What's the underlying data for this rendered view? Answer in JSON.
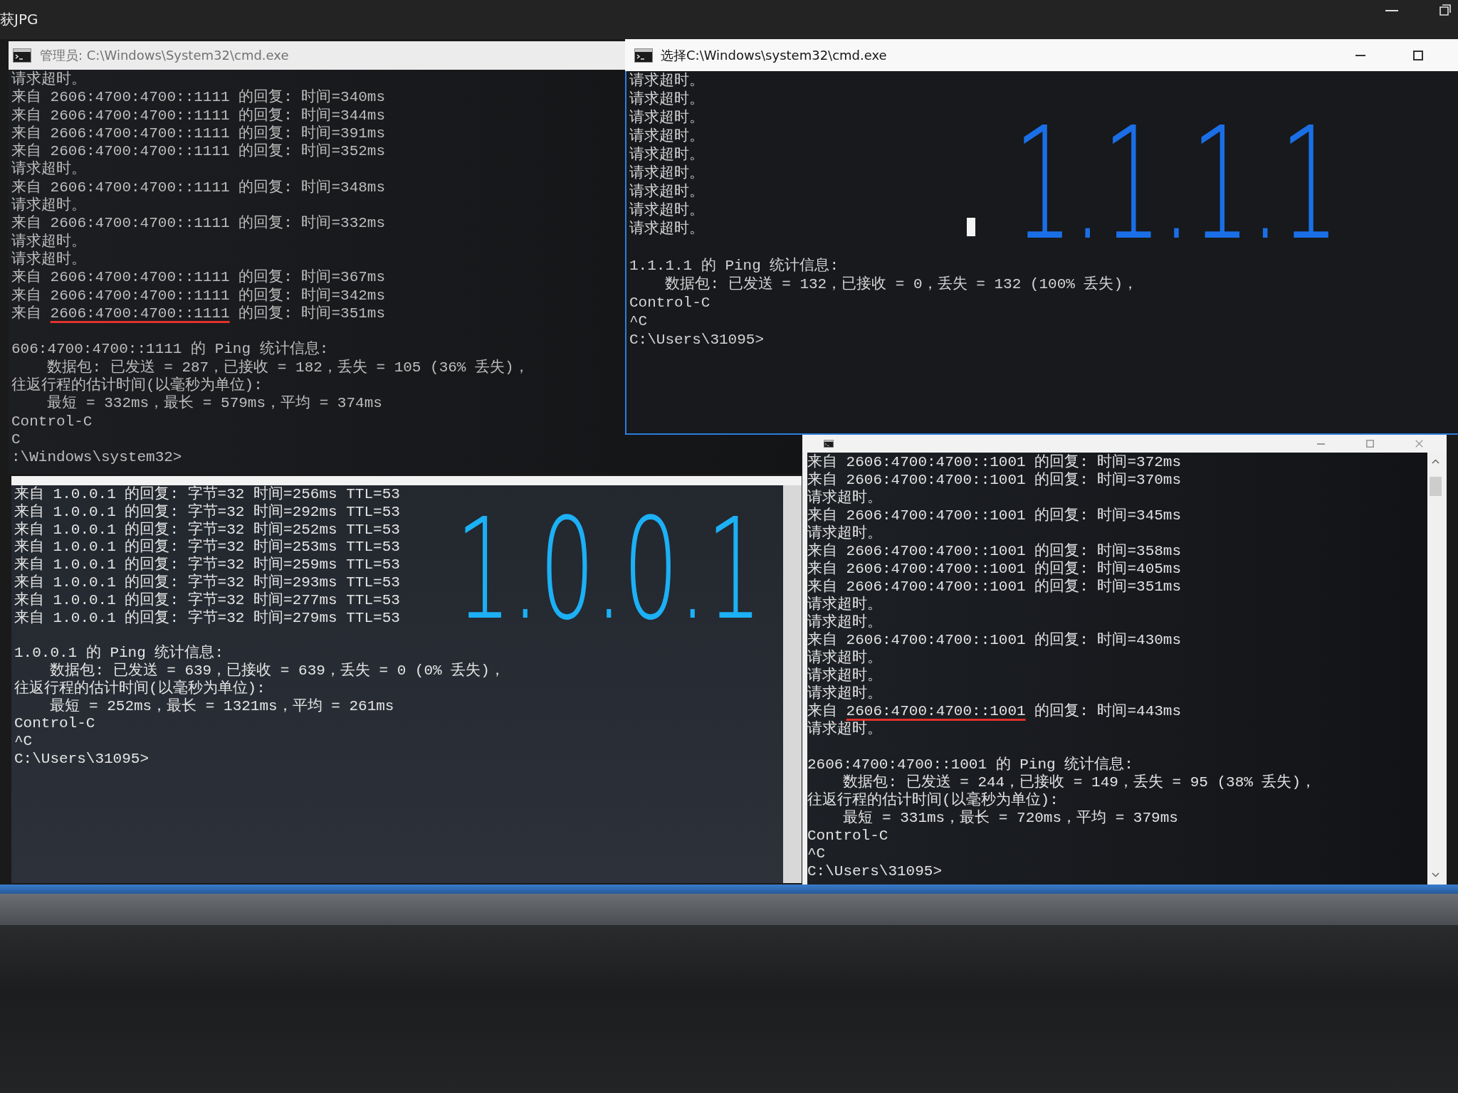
{
  "viewer": {
    "title": "获JPG"
  },
  "windows": [
    {
      "title": "管理员: C:\\Windows\\System32\\cmd.exe",
      "active": false,
      "cursor": false,
      "replies": [
        {
          "text": "请求超时。",
          "underlined": false
        },
        {
          "text": "来自 2606:4700:4700::1111 的回复: 时间=340ms",
          "underlined": false
        },
        {
          "text": "来自 2606:4700:4700::1111 的回复: 时间=344ms",
          "underlined": false
        },
        {
          "text": "来自 2606:4700:4700::1111 的回复: 时间=391ms",
          "underlined": false
        },
        {
          "text": "来自 2606:4700:4700::1111 的回复: 时间=352ms",
          "underlined": false
        },
        {
          "text": "请求超时。",
          "underlined": false
        },
        {
          "text": "来自 2606:4700:4700::1111 的回复: 时间=348ms",
          "underlined": false
        },
        {
          "text": "请求超时。",
          "underlined": false
        },
        {
          "text": "来自 2606:4700:4700::1111 的回复: 时间=332ms",
          "underlined": false
        },
        {
          "text": "请求超时。",
          "underlined": false
        },
        {
          "text": "请求超时。",
          "underlined": false
        },
        {
          "text": "来自 2606:4700:4700::1111 的回复: 时间=367ms",
          "underlined": false
        },
        {
          "text": "来自 2606:4700:4700::1111 的回复: 时间=342ms",
          "underlined": false
        },
        {
          "text": "来自 2606:4700:4700::1111 的回复: 时间=351ms",
          "underlined": true
        }
      ],
      "summary": [
        {
          "text": "606:4700:4700::1111 的 Ping 统计信息:",
          "indented": false
        },
        {
          "text": "数据包: 已发送 = 287，已接收 = 182，丢失 = 105 (36% 丢失)，",
          "indented": true
        },
        {
          "text": "往返行程的估计时间(以毫秒为单位):",
          "indented": false
        },
        {
          "text": "最短 = 332ms，最长 = 579ms，平均 = 374ms",
          "indented": true
        },
        {
          "text": "Control-C",
          "indented": false
        },
        {
          "text": "C",
          "indented": false
        },
        {
          "text": ":\\Windows\\system32>",
          "indented": false
        }
      ]
    },
    {
      "title": "选择C:\\Windows\\system32\\cmd.exe",
      "active": true,
      "cursor": true,
      "handwriting": {
        "text": "1.1.1.1",
        "color": "#1a6fe6"
      },
      "replies": [
        {
          "text": "请求超时。",
          "underlined": false
        },
        {
          "text": "请求超时。",
          "underlined": false
        },
        {
          "text": "请求超时。",
          "underlined": false
        },
        {
          "text": "请求超时。",
          "underlined": false
        },
        {
          "text": "请求超时。",
          "underlined": false
        },
        {
          "text": "请求超时。",
          "underlined": false
        },
        {
          "text": "请求超时。",
          "underlined": false
        },
        {
          "text": "请求超时。",
          "underlined": false
        },
        {
          "text": "请求超时。",
          "underlined": false
        }
      ],
      "summary": [
        {
          "text": "1.1.1.1 的 Ping 统计信息:",
          "indented": false
        },
        {
          "text": "数据包: 已发送 = 132，已接收 = 0，丢失 = 132 (100% 丢失)，",
          "indented": true
        },
        {
          "text": "Control-C",
          "indented": false
        },
        {
          "text": "^C",
          "indented": false
        },
        {
          "text": "C:\\Users\\31095>",
          "indented": false
        }
      ]
    },
    {
      "active": false,
      "cursor": false,
      "handwriting": {
        "text": "1.0.0.1",
        "color": "#1cb0f5"
      },
      "replies": [
        {
          "text": "来自 1.0.0.1 的回复: 字节=32 时间=256ms TTL=53",
          "underlined": false
        },
        {
          "text": "来自 1.0.0.1 的回复: 字节=32 时间=292ms TTL=53",
          "underlined": false
        },
        {
          "text": "来自 1.0.0.1 的回复: 字节=32 时间=252ms TTL=53",
          "underlined": false
        },
        {
          "text": "来自 1.0.0.1 的回复: 字节=32 时间=253ms TTL=53",
          "underlined": false
        },
        {
          "text": "来自 1.0.0.1 的回复: 字节=32 时间=259ms TTL=53",
          "underlined": false
        },
        {
          "text": "来自 1.0.0.1 的回复: 字节=32 时间=293ms TTL=53",
          "underlined": false
        },
        {
          "text": "来自 1.0.0.1 的回复: 字节=32 时间=277ms TTL=53",
          "underlined": false
        },
        {
          "text": "来自 1.0.0.1 的回复: 字节=32 时间=279ms TTL=53",
          "underlined": false
        }
      ],
      "summary": [
        {
          "text": "1.0.0.1 的 Ping 统计信息:",
          "indented": false
        },
        {
          "text": "数据包: 已发送 = 639，已接收 = 639，丢失 = 0 (0% 丢失)，",
          "indented": true
        },
        {
          "text": "往返行程的估计时间(以毫秒为单位):",
          "indented": false
        },
        {
          "text": "最短 = 252ms，最长 = 1321ms，平均 = 261ms",
          "indented": true
        },
        {
          "text": "Control-C",
          "indented": false
        },
        {
          "text": "^C",
          "indented": false
        },
        {
          "text": "C:\\Users\\31095>",
          "indented": false
        }
      ]
    },
    {
      "active": false,
      "cursor": false,
      "replies": [
        {
          "text": "来自 2606:4700:4700::1001 的回复: 时间=372ms",
          "underlined": false
        },
        {
          "text": "来自 2606:4700:4700::1001 的回复: 时间=370ms",
          "underlined": false
        },
        {
          "text": "请求超时。",
          "underlined": false
        },
        {
          "text": "来自 2606:4700:4700::1001 的回复: 时间=345ms",
          "underlined": false
        },
        {
          "text": "请求超时。",
          "underlined": false
        },
        {
          "text": "来自 2606:4700:4700::1001 的回复: 时间=358ms",
          "underlined": false
        },
        {
          "text": "来自 2606:4700:4700::1001 的回复: 时间=405ms",
          "underlined": false
        },
        {
          "text": "来自 2606:4700:4700::1001 的回复: 时间=351ms",
          "underlined": false
        },
        {
          "text": "请求超时。",
          "underlined": false
        },
        {
          "text": "请求超时。",
          "underlined": false
        },
        {
          "text": "来自 2606:4700:4700::1001 的回复: 时间=430ms",
          "underlined": false
        },
        {
          "text": "请求超时。",
          "underlined": false
        },
        {
          "text": "请求超时。",
          "underlined": false
        },
        {
          "text": "请求超时。",
          "underlined": false
        },
        {
          "text": "来自 2606:4700:4700::1001 的回复: 时间=443ms",
          "underlined": true
        },
        {
          "text": "请求超时。",
          "underlined": false
        }
      ],
      "summary": [
        {
          "text": "2606:4700:4700::1001 的 Ping 统计信息:",
          "indented": false
        },
        {
          "text": "数据包: 已发送 = 244，已接收 = 149，丢失 = 95 (38% 丢失)，",
          "indented": true
        },
        {
          "text": "往返行程的估计时间(以毫秒为单位):",
          "indented": false
        },
        {
          "text": "最短 = 331ms，最长 = 720ms，平均 = 379ms",
          "indented": true
        },
        {
          "text": "Control-C",
          "indented": false
        },
        {
          "text": "^C",
          "indented": false
        },
        {
          "text": "C:\\Users\\31095>",
          "indented": false
        }
      ]
    }
  ]
}
